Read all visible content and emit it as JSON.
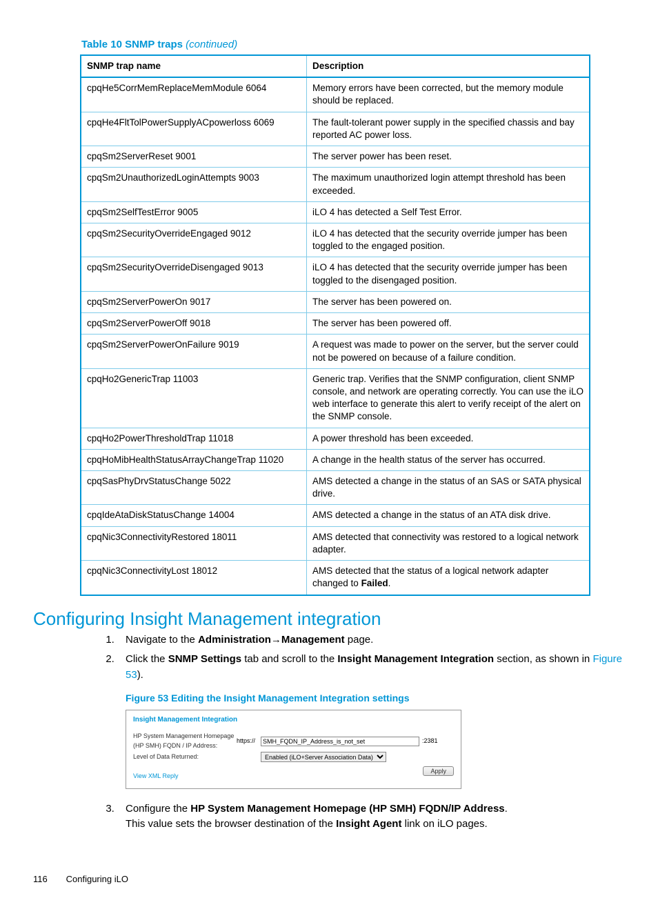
{
  "table": {
    "title_prefix": "Table 10 SNMP traps ",
    "title_suffix": "(continued)",
    "headers": [
      "SNMP trap name",
      "Description"
    ],
    "rows": [
      {
        "name": "cpqHe5CorrMemReplaceMemModule 6064",
        "desc": "Memory errors have been corrected, but the memory module should be replaced."
      },
      {
        "name": "cpqHe4FltTolPowerSupplyACpowerloss 6069",
        "desc": "The fault-tolerant power supply in the specified chassis and bay reported AC power loss."
      },
      {
        "name": "cpqSm2ServerReset 9001",
        "desc": "The server power has been reset."
      },
      {
        "name": "cpqSm2UnauthorizedLoginAttempts 9003",
        "desc": "The maximum unauthorized login attempt threshold has been exceeded."
      },
      {
        "name": "cpqSm2SelfTestError 9005",
        "desc": "iLO 4 has detected a Self Test Error."
      },
      {
        "name": "cpqSm2SecurityOverrideEngaged 9012",
        "desc": "iLO 4 has detected that the security override jumper has been toggled to the engaged position."
      },
      {
        "name": "cpqSm2SecurityOverrideDisengaged 9013",
        "desc": "iLO 4 has detected that the security override jumper has been toggled to the disengaged position."
      },
      {
        "name": "cpqSm2ServerPowerOn 9017",
        "desc": "The server has been powered on."
      },
      {
        "name": "cpqSm2ServerPowerOff 9018",
        "desc": "The server has been powered off."
      },
      {
        "name": "cpqSm2ServerPowerOnFailure 9019",
        "desc": "A request was made to power on the server, but the server could not be powered on because of a failure condition."
      },
      {
        "name": "cpqHo2GenericTrap 11003",
        "desc": "Generic trap. Verifies that the SNMP configuration, client SNMP console, and network are operating correctly. You can use the iLO web interface to generate this alert to verify receipt of the alert on the SNMP console."
      },
      {
        "name": "cpqHo2PowerThresholdTrap 11018",
        "desc": "A power threshold has been exceeded."
      },
      {
        "name": "cpqHoMibHealthStatusArrayChangeTrap 11020",
        "desc": "A change in the health status of the server has occurred."
      },
      {
        "name": "cpqSasPhyDrvStatusChange 5022",
        "desc": "AMS detected a change in the status of an SAS or SATA physical drive."
      },
      {
        "name": "cpqIdeAtaDiskStatusChange 14004",
        "desc": "AMS detected a change in the status of an ATA disk drive."
      },
      {
        "name": "cpqNic3ConnectivityRestored 18011",
        "desc": "AMS detected that connectivity was restored to a logical network adapter."
      },
      {
        "name": "cpqNic3ConnectivityLost 18012",
        "desc_pre": "AMS detected that the status of a logical network adapter changed to ",
        "desc_bold": "Failed",
        "desc_post": "."
      }
    ]
  },
  "section": {
    "heading": "Configuring Insight Management integration"
  },
  "steps": {
    "s1": {
      "pre": "Navigate to the ",
      "b1": "Administration",
      "arrow": "→",
      "b2": "Management",
      "post": " page."
    },
    "s2": {
      "pre": "Click the ",
      "b1": "SNMP Settings",
      "mid": " tab and scroll to the ",
      "b2": "Insight Management Integration",
      "post": " section, as shown in ",
      "link": "Figure 53",
      "end": ")."
    },
    "s3": {
      "pre": "Configure the ",
      "b1": "HP System Management Homepage (HP SMH) FQDN/IP Address",
      "post": ".",
      "line2_pre": "This value sets the browser destination of the ",
      "line2_b": "Insight Agent",
      "line2_post": " link on iLO pages."
    }
  },
  "figure": {
    "caption": "Figure 53 Editing the Insight Management Integration settings",
    "title": "Insight Management Integration",
    "row1_label": "HP System Management Homepage (HP SMH) FQDN / IP Address:",
    "proto": "https://",
    "input_val": "SMH_FQDN_IP_Address_is_not_set",
    "port": ":2381",
    "row2_label": "Level of Data Returned:",
    "select_val": "Enabled (iLO+Server Association Data)",
    "link": "View XML Reply",
    "apply": "Apply"
  },
  "footer": {
    "pagenum": "116",
    "section": "Configuring iLO"
  }
}
